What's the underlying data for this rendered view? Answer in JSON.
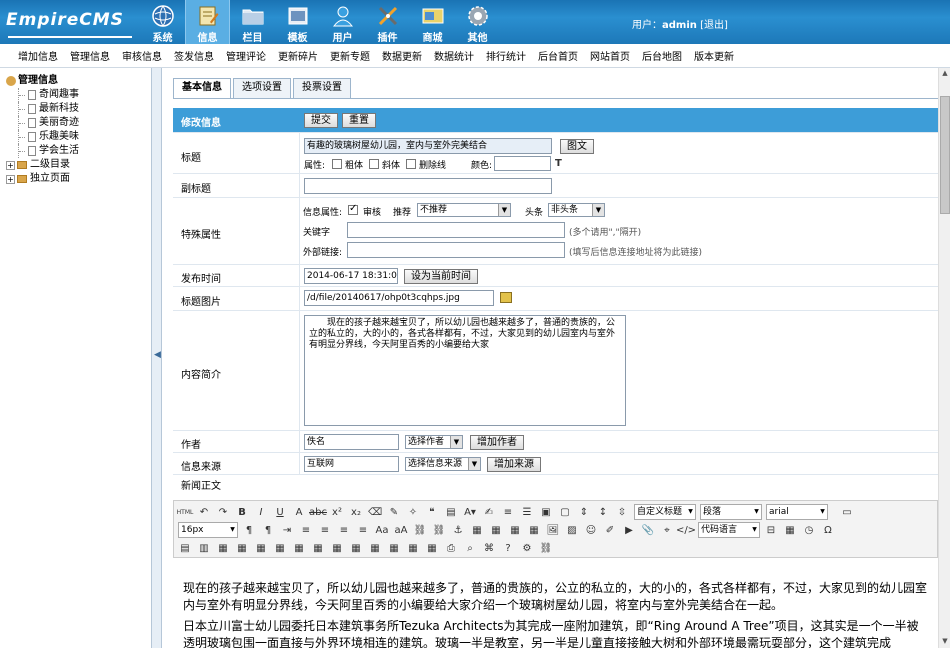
{
  "header": {
    "logo_text": "EmpireCMS",
    "nav": [
      {
        "label": "系统",
        "icon": "globe-icon"
      },
      {
        "label": "信息",
        "icon": "edit-icon",
        "active": true
      },
      {
        "label": "栏目",
        "icon": "folder-icon"
      },
      {
        "label": "模板",
        "icon": "template-icon"
      },
      {
        "label": "用户",
        "icon": "user-icon"
      },
      {
        "label": "插件",
        "icon": "tools-icon"
      },
      {
        "label": "商城",
        "icon": "shop-icon"
      },
      {
        "label": "其他",
        "icon": "gear-icon"
      }
    ],
    "user_label": "用户：",
    "user_name": "admin",
    "logout": "[退出]"
  },
  "subnav": [
    "增加信息",
    "管理信息",
    "审核信息",
    "签发信息",
    "管理评论",
    "更新碎片",
    "更新专题",
    "数据更新",
    "数据统计",
    "排行统计",
    "后台首页",
    "网站首页",
    "后台地图",
    "版本更新"
  ],
  "tree": {
    "root": "管理信息",
    "items": [
      "奇闻趣事",
      "最新科技",
      "美丽奇迹",
      "乐趣美味",
      "学会生活"
    ],
    "folders": [
      "二级目录",
      "独立页面"
    ]
  },
  "tabs": [
    "基本信息",
    "选项设置",
    "投票设置"
  ],
  "form": {
    "section_title": "修改信息",
    "submit": "提交",
    "reset": "重置",
    "title_label": "标题",
    "title_value": "有趣的玻璃树屋幼儿园，室内与室外完美结合",
    "title_pic_btn": "图文",
    "attr_label": "属性:",
    "bold": "粗体",
    "italic": "斜体",
    "strike": "删除线",
    "color_label": "颜色:",
    "subtitle_label": "副标题",
    "special_label": "特殊属性",
    "info_attr": "信息属性:",
    "review": "审核",
    "recommend": "推荐",
    "recommend_value": "不推荐",
    "headline": "头条",
    "headline_value": "非头条",
    "keyword_label": "关键字",
    "keyword_hint": "(多个请用\",\"隔开)",
    "link_label": "外部链接:",
    "link_hint": "(填写后信息连接地址将为此链接)",
    "time_label": "发布时间",
    "time_value": "2014-06-17 18:31:04",
    "time_btn": "设为当前时间",
    "pic_label": "标题图片",
    "pic_value": "/d/file/20140617/ohp0t3cqhps.jpg",
    "summary_label": "内容简介",
    "summary_value": "　　现在的孩子越来越宝贝了，所以幼儿园也越来越多了，普通的贵族的，公立的私立的，大的小的，各式各样都有，不过，大家见到的幼儿园室内与室外有明显分界线，今天阿里百秀的小编要给大家",
    "author_label": "作者",
    "author_value": "佚名",
    "author_select": "选择作者",
    "author_btn": "增加作者",
    "source_label": "信息来源",
    "source_value": "互联网",
    "source_select": "选择信息来源",
    "source_btn": "增加来源",
    "body_label": "新闻正文"
  },
  "editor": {
    "style_select": "自定义标题",
    "para_select": "段落",
    "font_select": "arial",
    "size_select": "16px",
    "code_select": "代码语言",
    "content_p1": "现在的孩子越来越宝贝了，所以幼儿园也越来越多了，普通的贵族的，公立的私立的，大的小的，各式各样都有，不过，大家见到的幼儿园室内与室外有明显分界线，今天阿里百秀的小编要给大家介绍一个玻璃树屋幼儿园，将室内与室外完美结合在一起。",
    "content_p2": "日本立川富士幼儿园委托日本建筑事务所Tezuka Architects为其完成一座附加建筑，即“Ring Around A Tree”项目，这其实是一个一半被透明玻璃包围一面直接与外界环境相连的建筑。玻璃一半是教室，另一半是儿童直接接触大树和外部环境最需玩耍部分，这个建筑完成"
  }
}
